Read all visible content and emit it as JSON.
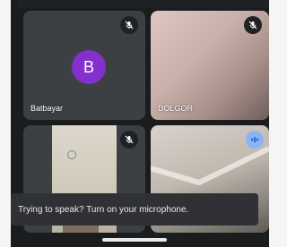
{
  "participants": [
    {
      "name": "Batbayar",
      "avatar_letter": "B",
      "avatar_color": "#8430ce",
      "muted": true
    },
    {
      "name": "DOLGOR",
      "muted": true
    },
    {
      "name": "",
      "muted": true
    },
    {
      "name": "",
      "speaking": true
    }
  ],
  "toast": {
    "message": "Trying to speak? Turn on your microphone."
  },
  "icons": {
    "muted": "mic-off-icon",
    "speaking": "audio-wave-icon"
  },
  "colors": {
    "screen_bg": "#1b1c1e",
    "tile_bg": "#3c4043",
    "toast_bg": "#303134",
    "speaking_badge": "#8ab4f8"
  }
}
